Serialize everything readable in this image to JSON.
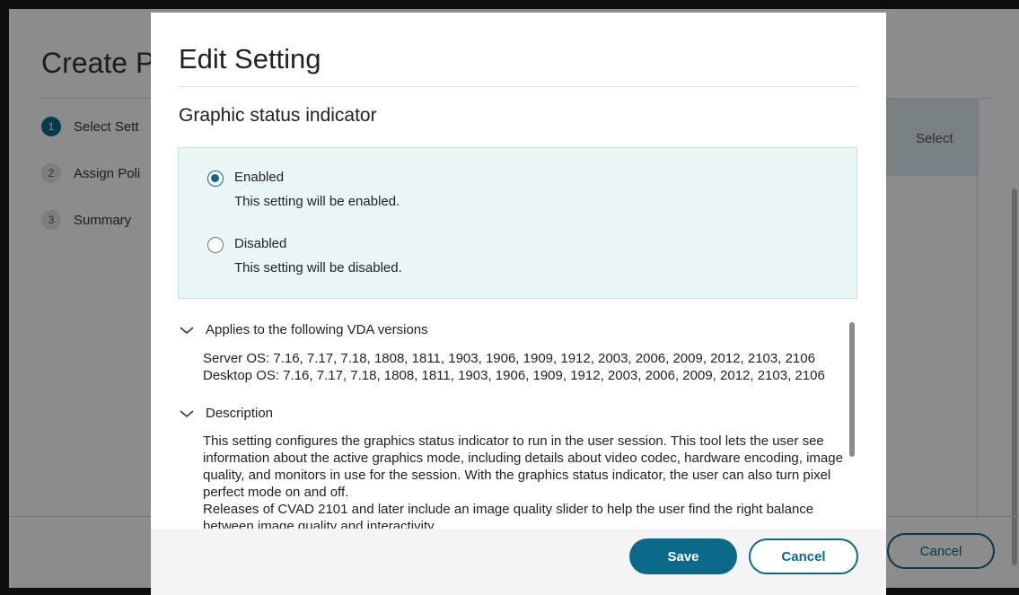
{
  "background": {
    "page_title": "Create P",
    "steps": [
      {
        "num": "1",
        "label": "Select Sett"
      },
      {
        "num": "2",
        "label": "Assign Poli"
      },
      {
        "num": "3",
        "label": "Summary"
      }
    ],
    "select_label": "Select",
    "cancel_label": "Cancel"
  },
  "dialog": {
    "title": "Edit Setting",
    "setting_name": "Graphic status indicator",
    "options": [
      {
        "label": "Enabled",
        "description": "This setting will be enabled.",
        "selected": true
      },
      {
        "label": "Disabled",
        "description": "This setting will be disabled.",
        "selected": false
      }
    ],
    "applies": {
      "heading": "Applies to the following VDA versions",
      "server": "Server OS: 7.16, 7.17, 7.18, 1808, 1811, 1903, 1906, 1909, 1912, 2003, 2006, 2009, 2012, 2103, 2106",
      "desktop": "Desktop OS: 7.16, 7.17, 7.18, 1808, 1811, 1903, 1906, 1909, 1912, 2003, 2006, 2009, 2012, 2103, 2106"
    },
    "description": {
      "heading": "Description",
      "para1": "This setting configures the graphics status indicator to run in the user session. This tool lets the user see information about the active graphics mode, including details about video codec, hardware encoding, image quality, and monitors in use for the session. With the graphics status indicator, the user can also turn pixel perfect mode on and off.",
      "para2": "Releases of CVAD 2101 and later include an image quality slider to help the user find the right balance between image quality and interactivity."
    },
    "save_label": "Save",
    "cancel_label": "Cancel"
  }
}
